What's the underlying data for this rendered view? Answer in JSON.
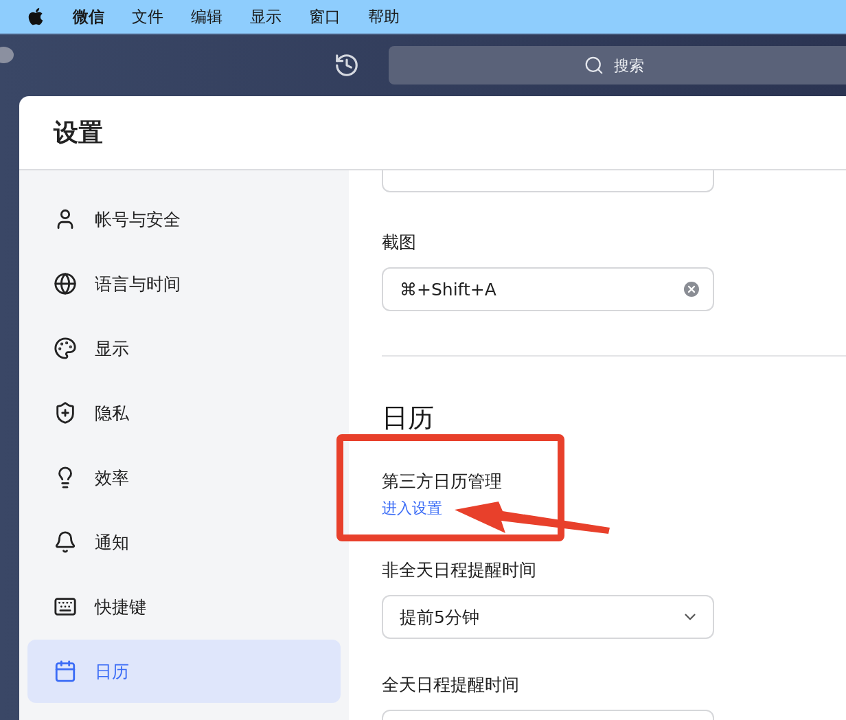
{
  "menu_bar": {
    "items": [
      {
        "label": "微信",
        "bold": true
      },
      {
        "label": "文件",
        "bold": false
      },
      {
        "label": "编辑",
        "bold": false
      },
      {
        "label": "显示",
        "bold": false
      },
      {
        "label": "窗口",
        "bold": false
      },
      {
        "label": "帮助",
        "bold": false
      }
    ]
  },
  "toolbar": {
    "search": {
      "placeholder": "搜索"
    }
  },
  "settings": {
    "title": "设置",
    "sidebar": {
      "items": [
        {
          "label": "帐号与安全",
          "selected": false
        },
        {
          "label": "语言与时间",
          "selected": false
        },
        {
          "label": "显示",
          "selected": false
        },
        {
          "label": "隐私",
          "selected": false
        },
        {
          "label": "效率",
          "selected": false
        },
        {
          "label": "通知",
          "selected": false
        },
        {
          "label": "快捷键",
          "selected": false
        },
        {
          "label": "日历",
          "selected": true
        }
      ]
    },
    "content": {
      "shortcut": {
        "label": "截图",
        "value": "⌘+Shift+A"
      },
      "section_title": "日历",
      "third_party": {
        "label": "第三方日历管理",
        "link": "进入设置"
      },
      "reminders": [
        {
          "label": "非全天日程提醒时间",
          "value": "提前5分钟"
        },
        {
          "label": "全天日程提醒时间"
        }
      ]
    }
  }
}
